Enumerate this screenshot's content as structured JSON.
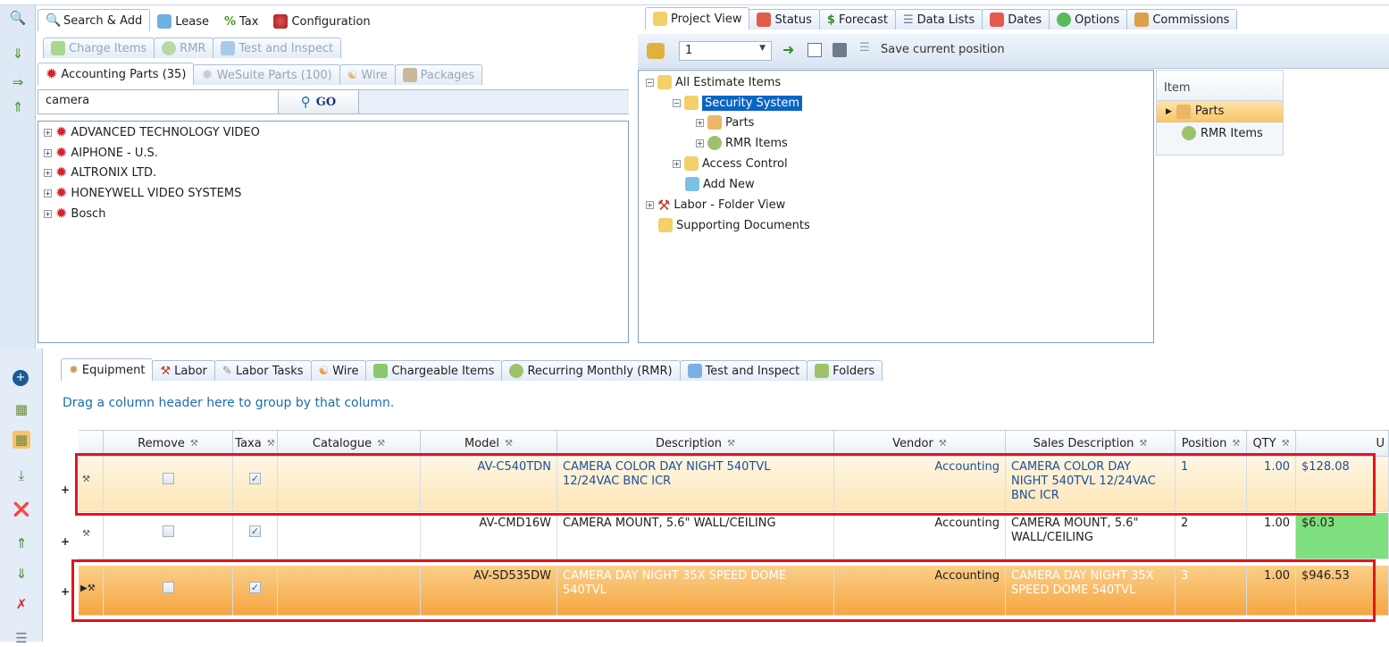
{
  "search_panel": {
    "main_tabs": [
      {
        "label": "Search & Add",
        "icon": "magnifier-icon"
      },
      {
        "label": "Lease",
        "icon": "lease-icon"
      },
      {
        "label": "Tax",
        "icon": "percent-icon"
      },
      {
        "label": "Configuration",
        "icon": "configuration-icon"
      }
    ],
    "sub_tabs_row1": [
      "Charge Items",
      "RMR",
      "Test and Inspect"
    ],
    "sub_tabs_row2": [
      "Accounting Parts (35)",
      "WeSuite Parts (100)",
      "Wire",
      "Packages"
    ],
    "search_value": "camera",
    "go_label": "GO",
    "vendors": [
      "ADVANCED TECHNOLOGY VIDEO",
      "AIPHONE - U.S.",
      "ALTRONIX LTD.",
      "HONEYWELL VIDEO SYSTEMS",
      "Bosch"
    ]
  },
  "project_panel": {
    "tabs": [
      "Project View",
      "Status",
      "Forecast",
      "Data Lists",
      "Dates",
      "Options",
      "Commissions"
    ],
    "toolbar": {
      "select_value": "1",
      "save_label": "Save current position"
    },
    "tree": [
      {
        "label": "All Estimate Items",
        "level": 0,
        "expander": "−"
      },
      {
        "label": "Security System",
        "level": 1,
        "expander": "−",
        "selected": true
      },
      {
        "label": "Parts",
        "level": 2,
        "expander": "+"
      },
      {
        "label": "RMR Items",
        "level": 2,
        "expander": "+"
      },
      {
        "label": "Access Control",
        "level": 1,
        "expander": "+"
      },
      {
        "label": "Add New",
        "level": 1,
        "expander": ""
      },
      {
        "label": "Labor - Folder View",
        "level": 0,
        "expander": "+"
      },
      {
        "label": "Supporting Documents",
        "level": 0,
        "expander": ""
      }
    ],
    "item_header": "Item",
    "items": [
      "Parts",
      "RMR Items"
    ]
  },
  "bottom_panel": {
    "tabs": [
      "Equipment",
      "Labor",
      "Labor Tasks",
      "Wire",
      "Chargeable Items",
      "Recurring Monthly (RMR)",
      "Test and Inspect",
      "Folders"
    ],
    "group_hint": "Drag a column header here to group by that column.",
    "columns": [
      "Remove",
      "Taxa",
      "Catalogue",
      "Model",
      "Description",
      "Vendor",
      "Sales Description",
      "Position",
      "QTY",
      "U"
    ],
    "rows": [
      {
        "model": "AV-C540TDN",
        "description": "CAMERA COLOR DAY NIGHT 540TVL 12/24VAC BNC ICR",
        "vendor": "Accounting",
        "sales_description": "CAMERA COLOR DAY NIGHT 540TVL 12/24VAC BNC ICR",
        "position": "1",
        "qty": "1.00",
        "price": "$128.08",
        "taxable": true,
        "remove": false
      },
      {
        "model": "AV-CMD16W",
        "description": "CAMERA MOUNT, 5.6\" WALL/CEILING",
        "vendor": "Accounting",
        "sales_description": "CAMERA MOUNT, 5.6\" WALL/CEILING",
        "position": "2",
        "qty": "1.00",
        "price": "$6.03",
        "taxable": true,
        "remove": false
      },
      {
        "model": "AV-SD535DW",
        "description": "CAMERA DAY NIGHT 35X SPEED DOME 540TVL",
        "vendor": "Accounting",
        "sales_description": "CAMERA DAY NIGHT 35X SPEED DOME 540TVL",
        "position": "3",
        "qty": "1.00",
        "price": "$946.53",
        "taxable": true,
        "remove": false
      }
    ]
  },
  "colors": {
    "accent_blue": "#1b4f9a",
    "highlight_red": "#e4151b",
    "selected_orange": "#f5a640",
    "price_green": "#7ee07e",
    "tree_select": "#0a64c8"
  }
}
